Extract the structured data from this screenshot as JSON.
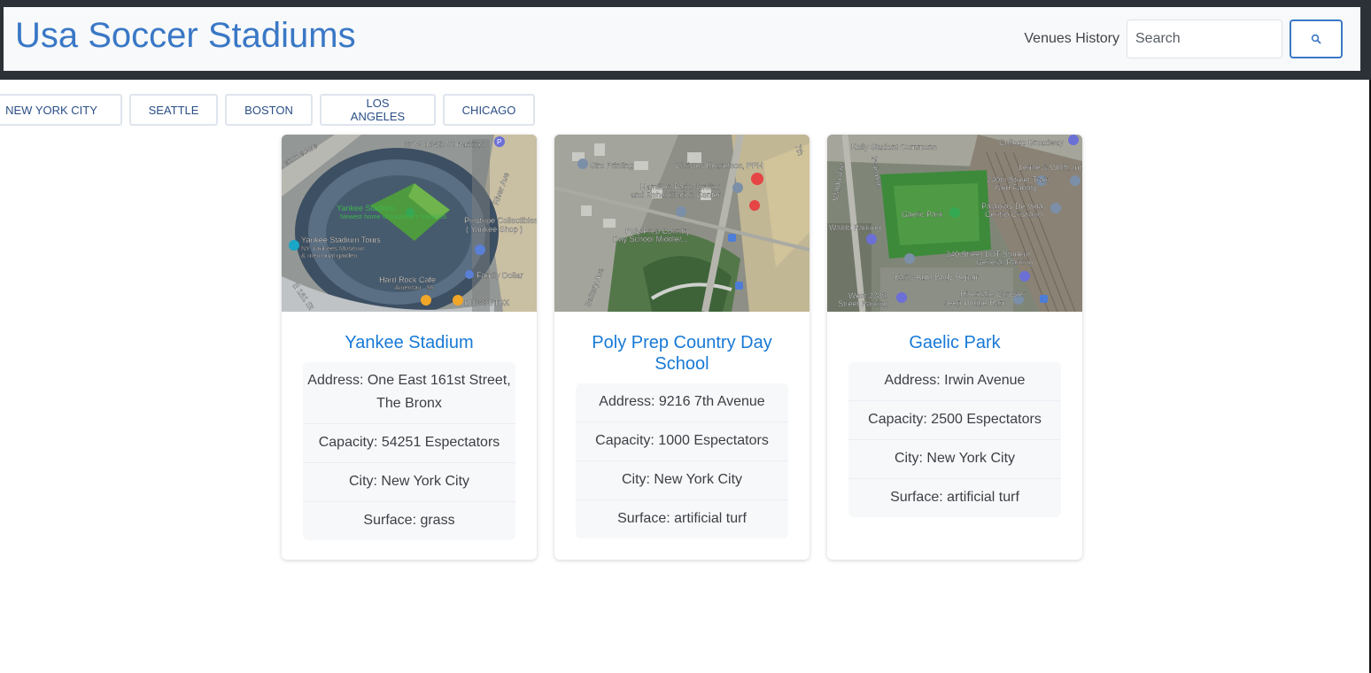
{
  "header": {
    "brand": "Usa Soccer Stadiums",
    "nav_link": "Venues History",
    "search_placeholder": "Search"
  },
  "cities": [
    "NEW YORK CITY",
    "SEATTLE",
    "BOSTON",
    "LOS ANGELES",
    "CHICAGO"
  ],
  "venues": [
    {
      "name": "Yankee Stadium",
      "address": "Address: One East 161st Street, The Bronx",
      "capacity": "Capacity: 54251 Espectators",
      "city": "City: New York City",
      "surface": "Surface: grass",
      "map_labels": [
        "65 W 164th St Parking",
        "Yankee Stadium",
        "Newest home of baseball's Yankees",
        "Yankee Stadium Tours",
        "NY Yankees Museum",
        "& memorial garden",
        "Pinstripe Collectibles",
        "( Yankee Shop )",
        "Hard Rock Cafe",
        "American · $$",
        "Family Dollar",
        "DUGOUTBX",
        "River Ave",
        "E 161 St",
        "Jerome Ave"
      ]
    },
    {
      "name": "Poly Prep Country Day School",
      "address": "Address: 9216 7th Avenue",
      "capacity": "Capacity: 1000 Espectators",
      "city": "City: New York City",
      "surface": "Surface: artificial turf",
      "map_labels": [
        "Sire Printing",
        "Christos Kouretsos, PPH",
        "Hamilton Park Nursing",
        "and Rehabilitation Center",
        "Poly Prep Country",
        "Day School Middle/...",
        "7th",
        "Battery Ave"
      ]
    },
    {
      "name": "Gaelic Park",
      "address": "Address: Irwin Avenue",
      "capacity": "Capacity: 2500 Espectators",
      "city": "City: New York City",
      "surface": "Surface: artificial turf",
      "map_labels": [
        "Kelly Student Commons",
        "College Broadway",
        "Lemle & Wolff, Inc",
        "240th Street Train",
        "Yard Facility",
        "Gaelic Park",
        "Palabras De Vida",
        "Centro Cristiano",
        "Waldo Parking",
        "240 Street LOT Student",
        "General Parking",
        "Karl's Auto Body Repair",
        "West 238th",
        "Street Parking",
        "Riverdale Chrysler",
        "Jeep Dodge Ram",
        "Waldo Ave",
        "Irwin Ave"
      ]
    }
  ]
}
